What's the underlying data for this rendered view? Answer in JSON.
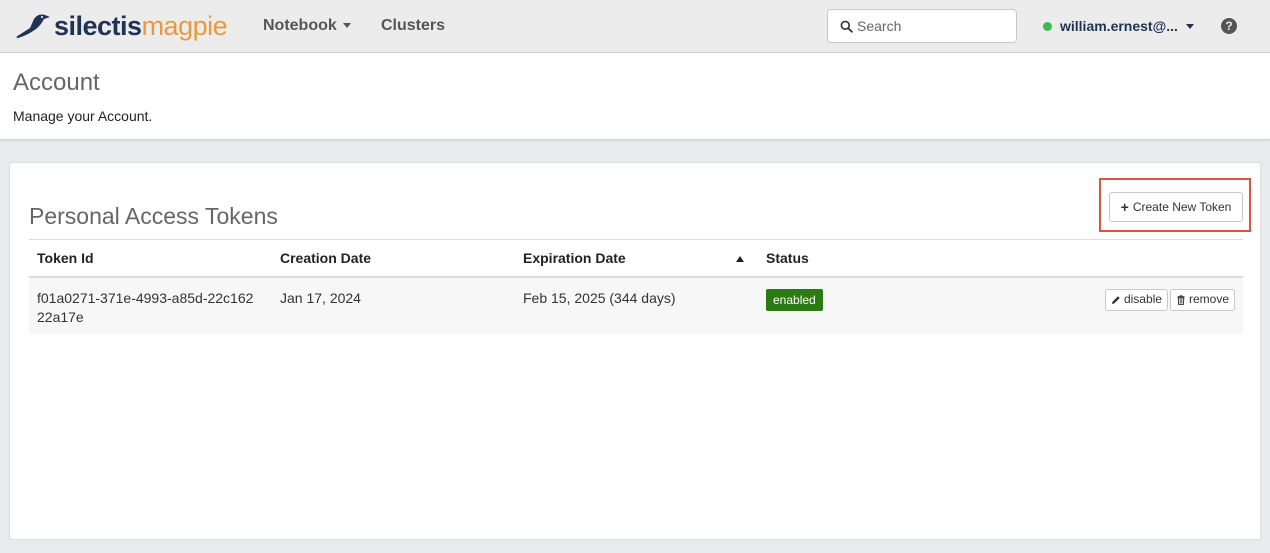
{
  "navbar": {
    "logo_primary": "silectis",
    "logo_secondary": "magpie",
    "nav_items": [
      "Notebook",
      "Clusters"
    ],
    "search_placeholder": "Search",
    "user_name": "william.ernest@...",
    "status_color": "#3fb950",
    "help_label": "?"
  },
  "page": {
    "title": "Account",
    "subtitle": "Manage your Account."
  },
  "tokens_panel": {
    "title": "Personal Access Tokens",
    "create_button_label": "Create New Token",
    "columns": [
      "Token Id",
      "Creation Date",
      "Expiration Date",
      "Status"
    ],
    "rows": [
      {
        "token_id_line1": "f01a0271-371e-4993-a85d-22c162",
        "token_id_line2": "22a17e",
        "creation_date": "Jan 17, 2024",
        "expiration_date": "Feb 15, 2025 (344 days)",
        "status": "enabled",
        "disable_label": "disable",
        "remove_label": "remove"
      }
    ]
  },
  "colors": {
    "brand_dark": "#1f3352",
    "brand_orange": "#e99a3d",
    "status_enabled": "#2b7a14",
    "highlight": "#d8573c"
  }
}
